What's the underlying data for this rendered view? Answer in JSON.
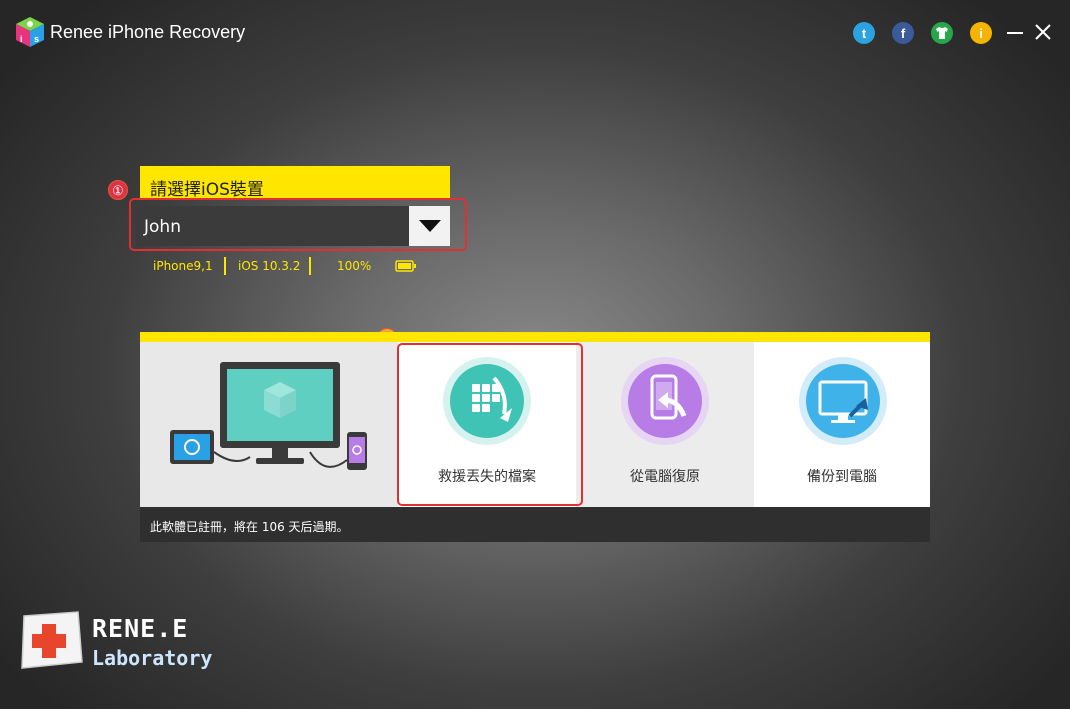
{
  "app": {
    "title": "Renee iPhone Recovery"
  },
  "titlebar": {
    "twitter_label": "t",
    "facebook_label": "f",
    "info_label": "i"
  },
  "device": {
    "label": "請選擇iOS裝置",
    "selected": "John",
    "model": "iPhone9,1",
    "ios": "iOS 10.3.2",
    "battery": "100%"
  },
  "steps": {
    "one": "①",
    "two": "②"
  },
  "functions": [
    {
      "label": "救援丟失的檔案",
      "icon": "recover-files-icon",
      "color": "#3fc3b5"
    },
    {
      "label": "從電腦復原",
      "icon": "restore-from-pc-icon",
      "color": "#b77ce6"
    },
    {
      "label": "備份到電腦",
      "icon": "backup-to-pc-icon",
      "color": "#3fb2ea"
    }
  ],
  "status": {
    "text": "此軟體已註冊，將在 106 天后過期。"
  },
  "brand": {
    "name": "RENE.E",
    "sub": "Laboratory"
  },
  "colors": {
    "accent_yellow": "#ffe600",
    "highlight_red": "#e03030",
    "status_bg": "#2f2f2f"
  }
}
